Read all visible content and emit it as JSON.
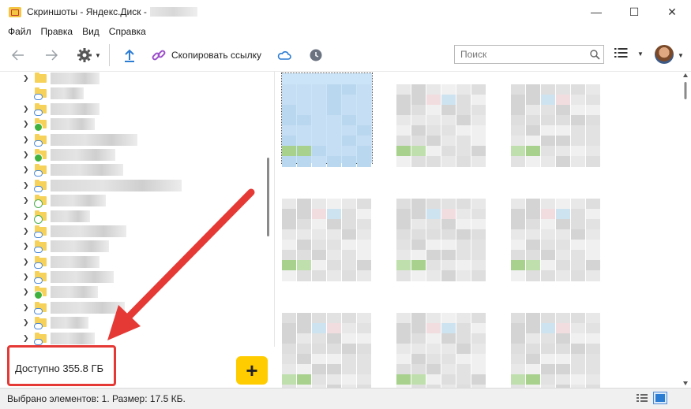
{
  "window": {
    "title": "Скриншоты - Яндекс.Диск -",
    "minimize_glyph": "—",
    "maximize_glyph": "☐",
    "close_glyph": "✕"
  },
  "menu": {
    "items": [
      "Файл",
      "Правка",
      "Вид",
      "Справка"
    ]
  },
  "toolbar": {
    "copy_link_label": "Скопировать ссылку",
    "icons": [
      "back-icon",
      "forward-icon",
      "gear-icon",
      "upload-icon",
      "link-icon",
      "cloud-icon",
      "history-icon",
      "list-view-icon"
    ]
  },
  "search": {
    "placeholder": "Поиск"
  },
  "sidebar": {
    "folder_badges": [
      "none",
      "cloud",
      "cloud",
      "check",
      "cloud",
      "check",
      "cloud",
      "cloud",
      "sync-dark",
      "sync",
      "cloud",
      "cloud",
      "cloud",
      "cloud",
      "check",
      "cloud",
      "cloud",
      "cloud"
    ]
  },
  "storage": {
    "available_label": "Доступно 355.8 ГБ"
  },
  "add_button": {
    "label": "+"
  },
  "status": {
    "text": "Выбрано элементов: 1. Размер: 17.5 КБ."
  },
  "colors": {
    "accent_yellow": "#ffcc00",
    "highlight_red": "#e53935",
    "selection_blue": "#cce4f7",
    "folder_yellow": "#f6d25b",
    "check_green": "#3eb13e",
    "cloud_blue": "#4d8bd8"
  }
}
